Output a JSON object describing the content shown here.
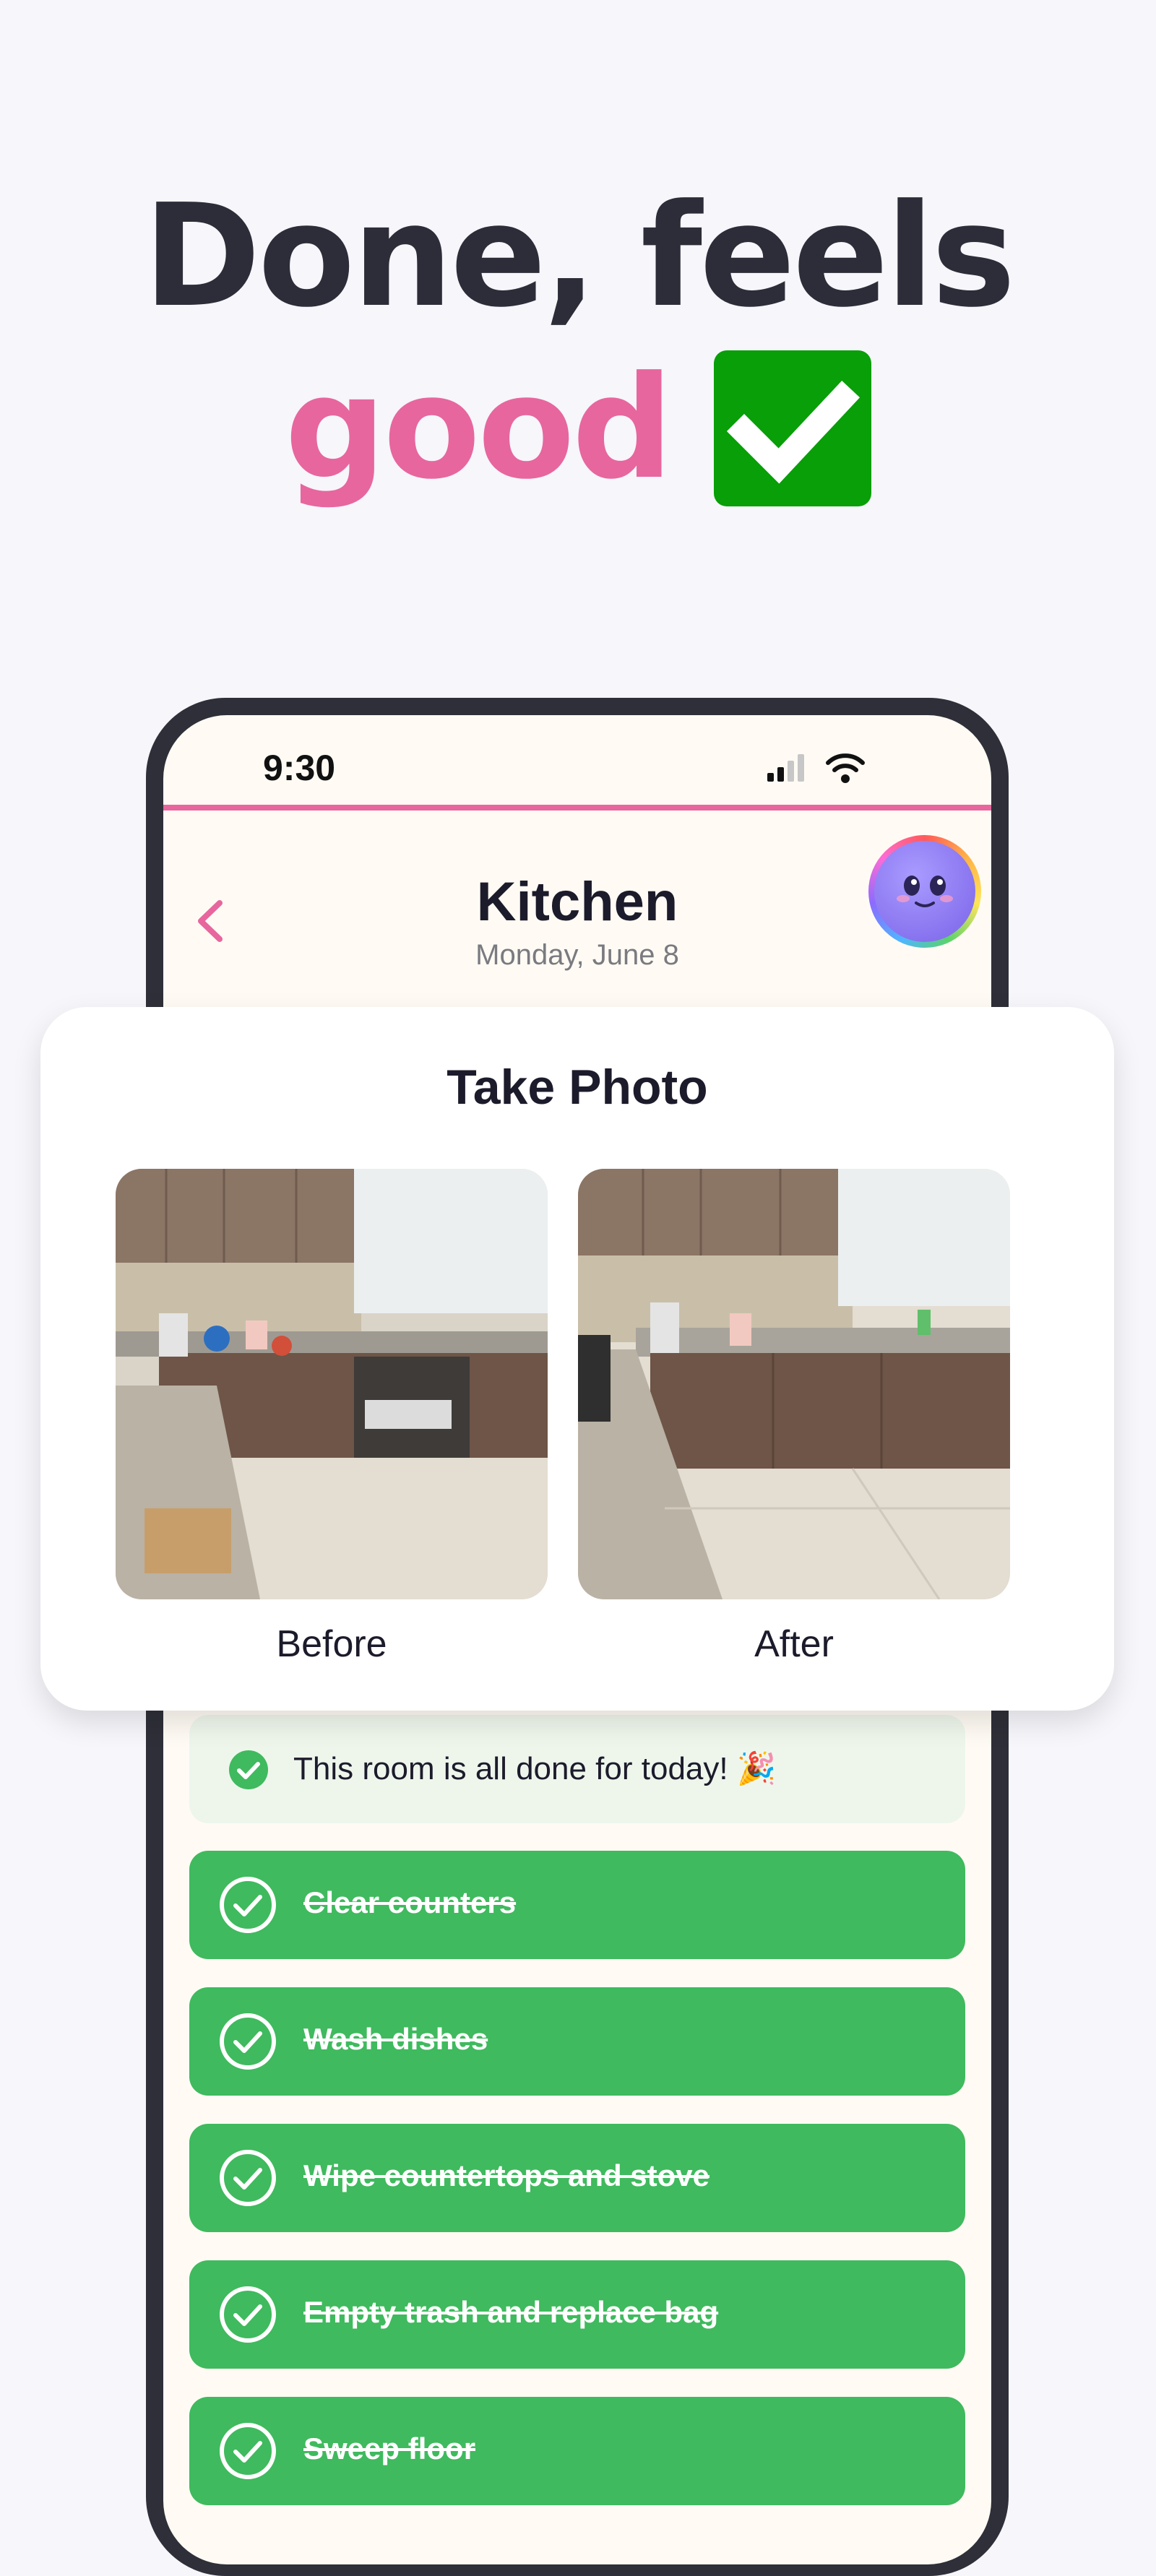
{
  "hero": {
    "line1": "Done, feels",
    "line2": "good",
    "check_emoji_color": "#089f08"
  },
  "status_bar": {
    "time": "9:30",
    "icons": [
      "signal-icon",
      "wifi-icon"
    ]
  },
  "header": {
    "title": "Kitchen",
    "date": "Monday, June 8",
    "accent_color": "#e7669e"
  },
  "photo_modal": {
    "title": "Take Photo",
    "before_label": "Before",
    "after_label": "After"
  },
  "done_banner": {
    "text": "This room is all done for today! 🎉"
  },
  "tasks": [
    {
      "label": "Clear counters",
      "done": true
    },
    {
      "label": "Wash dishes",
      "done": true
    },
    {
      "label": "Wipe countertops and stove",
      "done": true
    },
    {
      "label": "Empty trash and replace bag",
      "done": true
    },
    {
      "label": "Sweep floor",
      "done": true
    }
  ],
  "colors": {
    "task_done": "#3fba5e",
    "banner_bg": "#eef6ec",
    "phone_frame": "#2e2f38",
    "page_bg": "#f6f6fb"
  }
}
